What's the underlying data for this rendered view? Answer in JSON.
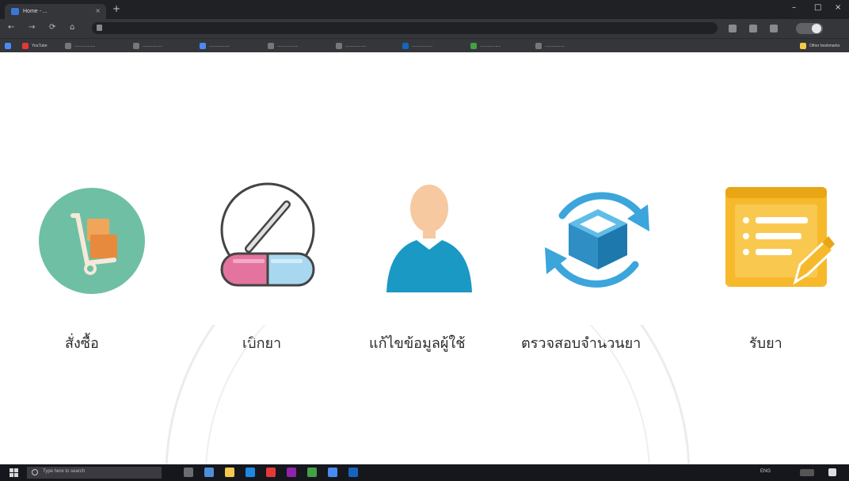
{
  "browser": {
    "tab_title": "Home - ...",
    "tab_close": "×",
    "new_tab": "+",
    "window_controls": [
      "–",
      "□",
      "×"
    ],
    "nav": {
      "back": "←",
      "forward": "→",
      "reload": "⟳",
      "home": "⌂"
    },
    "bookmarks": [
      {
        "label": "YouTube",
        "color": "#e53935"
      },
      {
        "label": "...................",
        "color": "#777777"
      },
      {
        "label": "..................",
        "color": "#777777"
      },
      {
        "label": "...................",
        "color": "#4a8af4"
      },
      {
        "label": "...................",
        "color": "#777777"
      },
      {
        "label": "...................",
        "color": "#777777"
      },
      {
        "label": "...................",
        "color": "#1565c0"
      },
      {
        "label": "...................",
        "color": "#43a047"
      },
      {
        "label": "..................",
        "color": "#777777"
      }
    ],
    "other_bookmarks": "Other bookmarks"
  },
  "menu": {
    "items": [
      {
        "id": "order",
        "label": "สั่งซื้อ",
        "icon": "hand-truck-icon"
      },
      {
        "id": "withdraw",
        "label": "เบิกยา",
        "icon": "pill-capsule-icon"
      },
      {
        "id": "edit-user",
        "label": "แก้ไขข้อมูลผู้ใช้",
        "icon": "user-icon"
      },
      {
        "id": "check-stock",
        "label": "ตรวจสอบจำนวนยา",
        "icon": "box-refresh-icon"
      },
      {
        "id": "receive",
        "label": "รับยา",
        "icon": "document-edit-icon"
      }
    ]
  },
  "taskbar": {
    "search_placeholder": "Type here to search",
    "tray_text": "ENG"
  },
  "colors": {
    "teal": "#6fbfa5",
    "pink": "#e4749f",
    "blue_light": "#a8d8f0",
    "skin": "#f6c9a0",
    "user_blue": "#1a99c4",
    "box_blue": "#3ba5dc",
    "doc_yellow": "#f7b92c"
  }
}
